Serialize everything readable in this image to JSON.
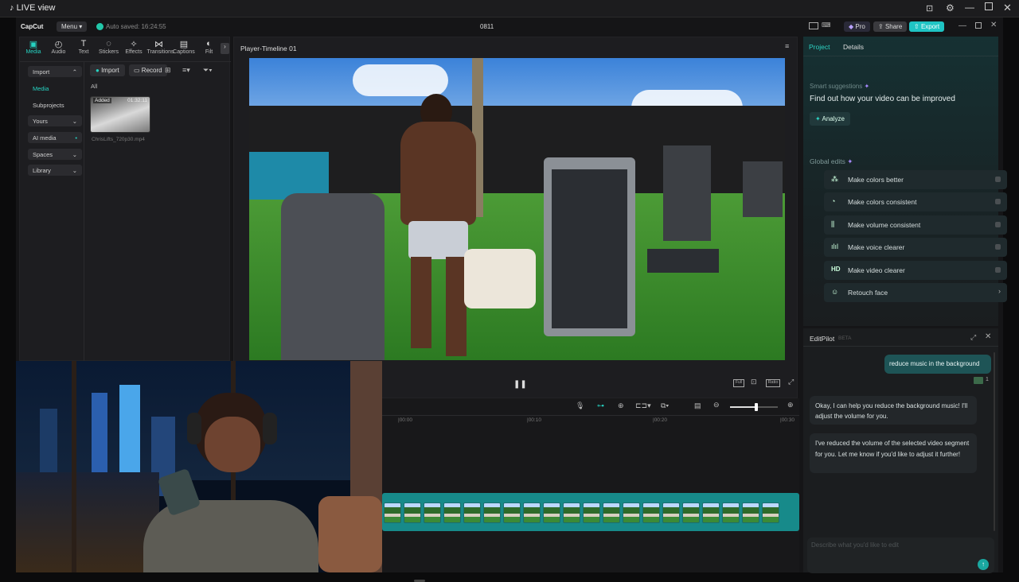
{
  "window": {
    "title": "LIVE view"
  },
  "app": {
    "logo": "CapCut",
    "menu_label": "Menu",
    "autosave": "Auto saved: 16:24:55",
    "project_name": "0811",
    "pro_label": "Pro",
    "share_label": "Share",
    "export_label": "Export"
  },
  "toolbar": {
    "items": [
      {
        "label": "Media",
        "icon": "media-icon"
      },
      {
        "label": "Audio",
        "icon": "audio-icon"
      },
      {
        "label": "Text",
        "icon": "text-icon"
      },
      {
        "label": "Stickers",
        "icon": "stickers-icon"
      },
      {
        "label": "Effects",
        "icon": "effects-icon"
      },
      {
        "label": "Transitions",
        "icon": "transitions-icon"
      },
      {
        "label": "Captions",
        "icon": "captions-icon"
      },
      {
        "label": "Filt",
        "icon": "filters-icon"
      }
    ]
  },
  "sidebar": {
    "items": [
      {
        "label": "Import"
      },
      {
        "label": "Media"
      },
      {
        "label": "Subprojects"
      },
      {
        "label": "Yours"
      },
      {
        "label": "AI media"
      },
      {
        "label": "Spaces"
      },
      {
        "label": "Library"
      }
    ]
  },
  "media": {
    "import_label": "Import",
    "record_label": "Record",
    "filter_all": "All",
    "clip": {
      "badge": "Added",
      "duration": "01:32:11",
      "filename": "ChrisLifts_720p30.mp4"
    }
  },
  "player": {
    "title": "Player-Timeline 01",
    "ratio_label": "Ratio"
  },
  "timeline": {
    "ticks": [
      "|00:00",
      "|00:10",
      "|00:20",
      "|00:30"
    ],
    "zoom_level": 0.55
  },
  "right_panel": {
    "tabs": [
      "Project",
      "Details"
    ],
    "smart_suggestions_label": "Smart suggestions",
    "smart_headline": "Find out how your video can be improved",
    "analyze_label": "Analyze",
    "global_edits_label": "Global edits",
    "global_edits": [
      {
        "label": "Make colors better",
        "icon": "sparkle-wand-icon"
      },
      {
        "label": "Make colors consistent",
        "icon": "palette-icon"
      },
      {
        "label": "Make volume consistent",
        "icon": "sliders-icon"
      },
      {
        "label": "Make voice clearer",
        "icon": "waveform-icon"
      },
      {
        "label": "Make video clearer",
        "icon": "hd-icon"
      },
      {
        "label": "Retouch face",
        "icon": "face-icon"
      }
    ]
  },
  "editpilot": {
    "title": "EditPilot",
    "beta": "BETA",
    "user_message": "reduce music in the background",
    "attach_count": "1",
    "bot_message_1": "Okay, I can help you reduce the background music! I'll adjust the volume for you.",
    "bot_message_2": "I've reduced the volume of the selected video segment for you. Let me know if you'd like to adjust it further!",
    "input_placeholder": "Describe what you'd like to edit"
  }
}
